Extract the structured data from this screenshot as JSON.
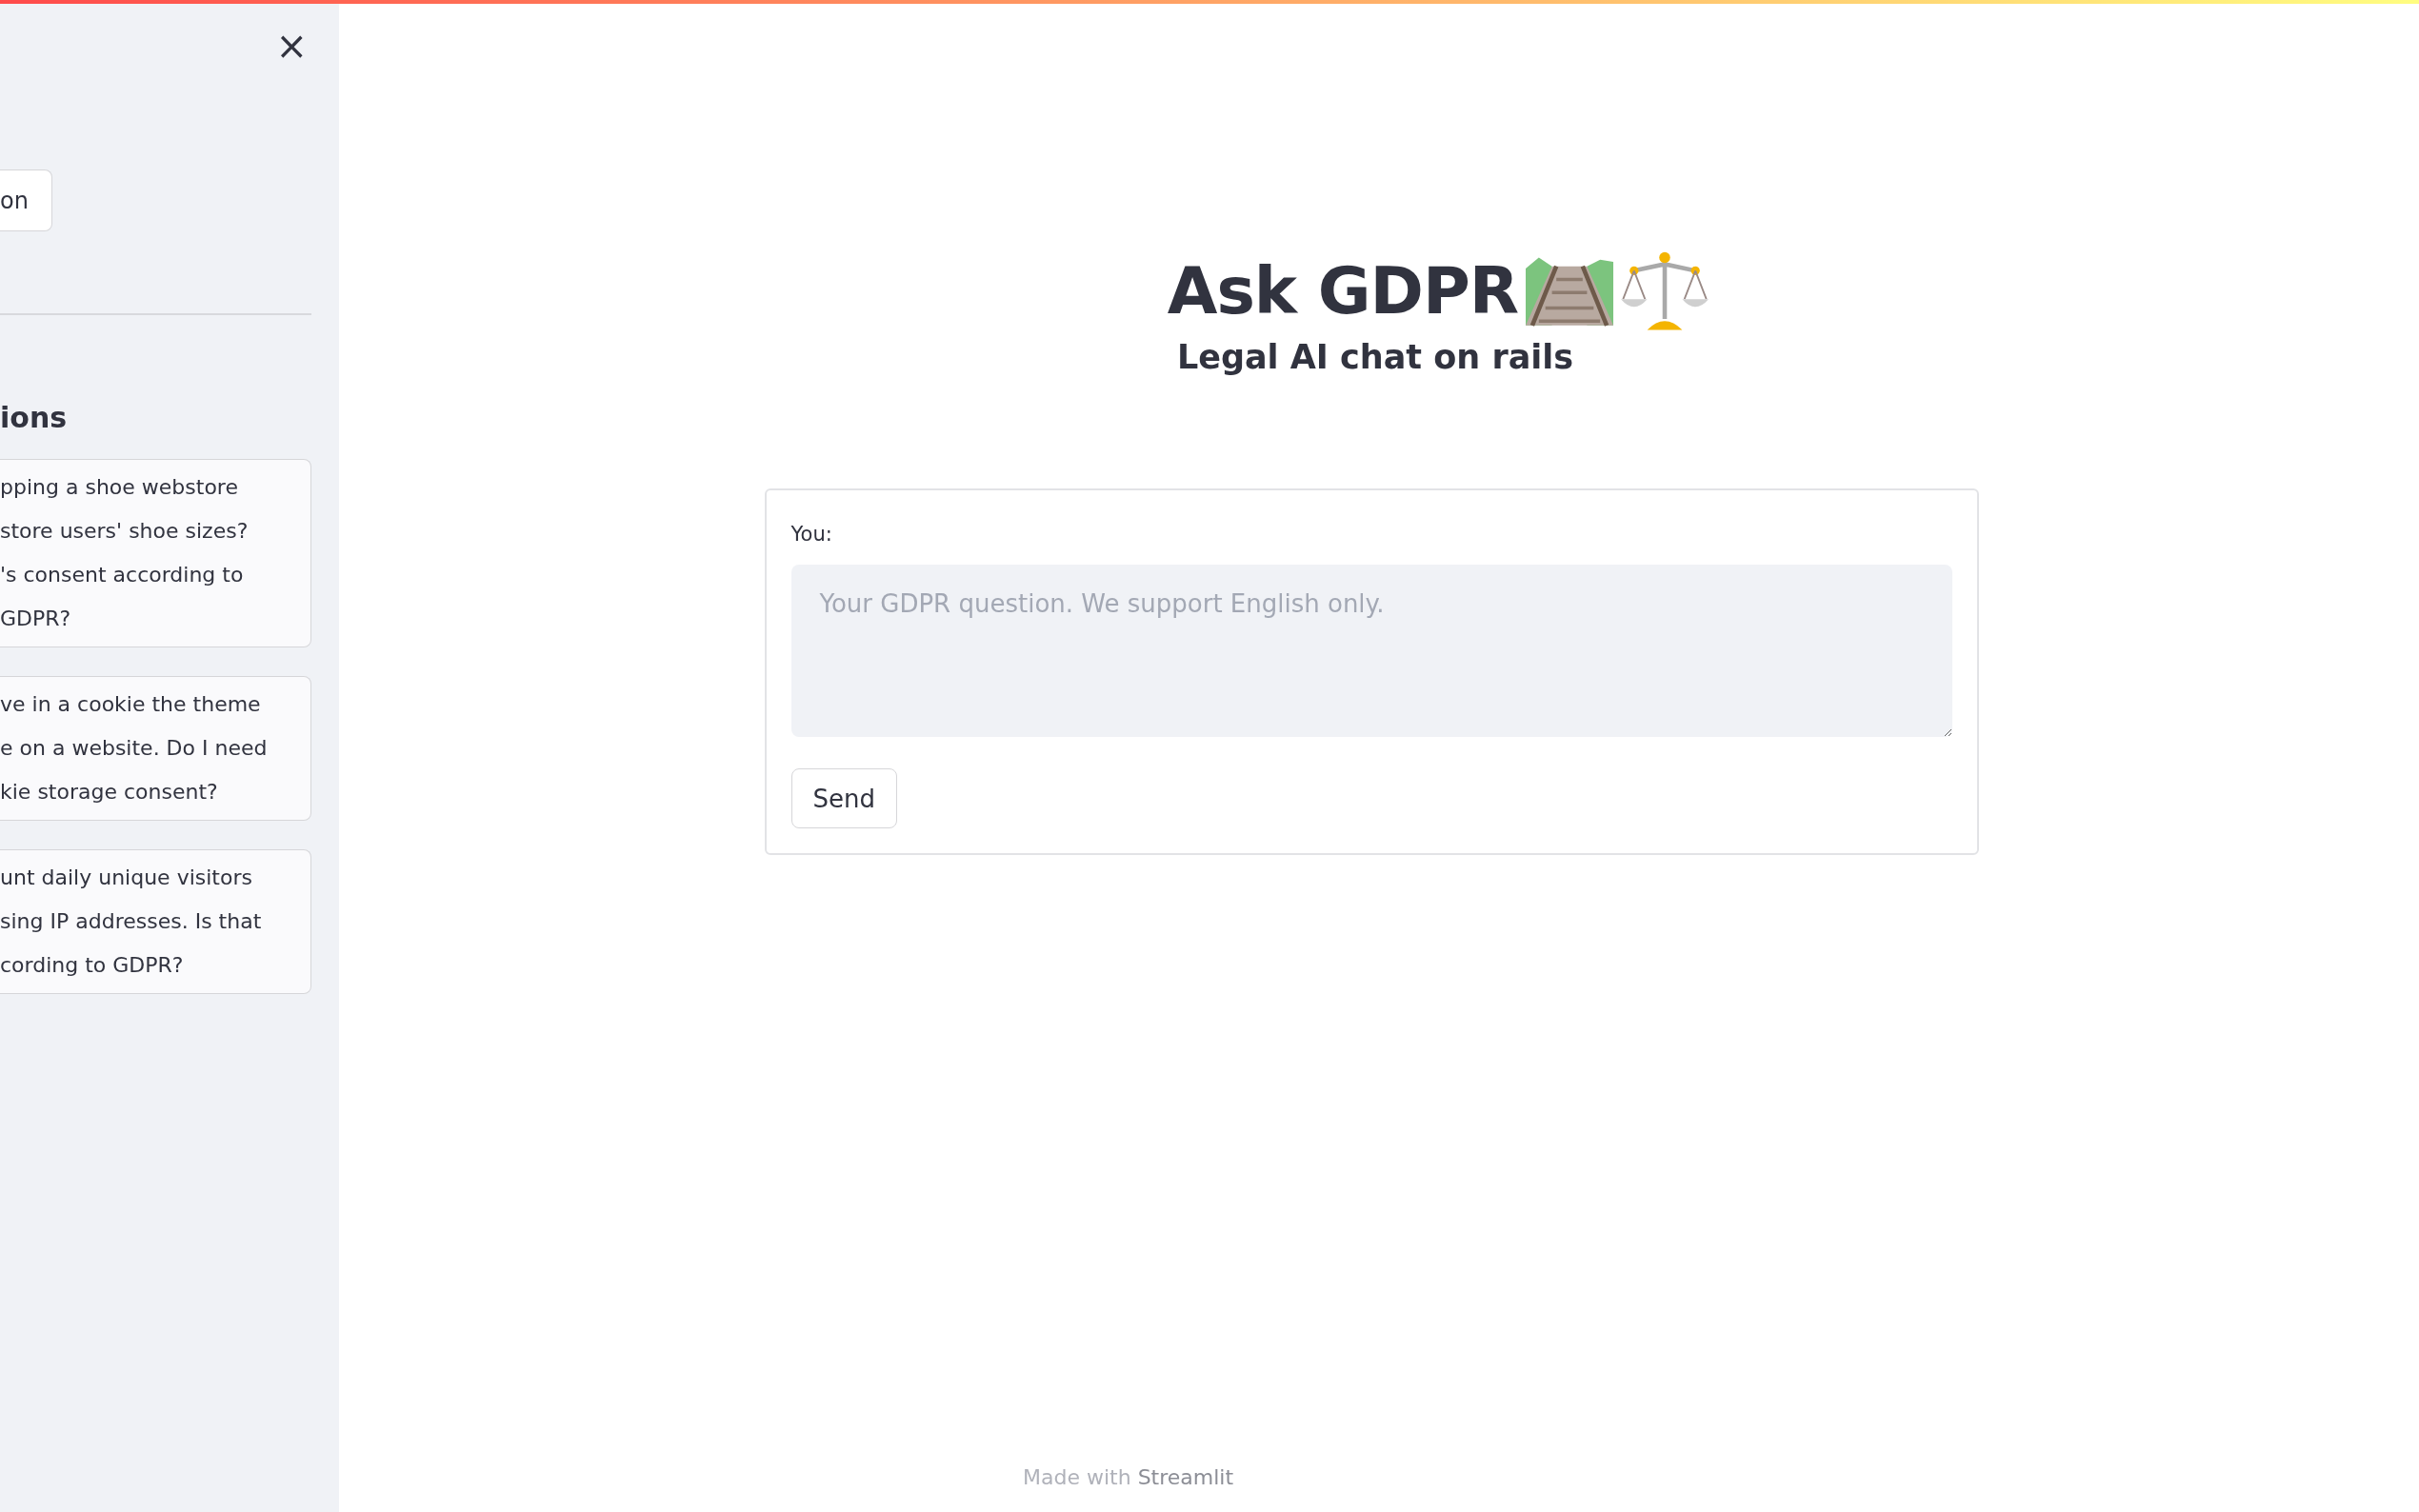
{
  "sidebar": {
    "close_button": "×",
    "button": "on",
    "heading": "ions",
    "questions": [
      {
        "lines": [
          "pping a shoe webstore",
          "store users' shoe sizes?",
          "'s consent according to",
          "GDPR?"
        ]
      },
      {
        "lines": [
          "ve in a cookie the theme",
          "e on a website. Do I need",
          "kie storage consent?"
        ]
      },
      {
        "lines": [
          "unt daily unique visitors",
          "sing IP addresses. Is that",
          "cording to GDPR?"
        ]
      }
    ]
  },
  "header": {
    "title": "Ask GDPR",
    "subtitle": "Legal AI chat on rails"
  },
  "chat_form": {
    "label": "You:",
    "placeholder": "Your GDPR question. We support English only.",
    "button": "Send"
  },
  "footer": {
    "prefix": "Made with",
    "brand": "Streamlit"
  }
}
